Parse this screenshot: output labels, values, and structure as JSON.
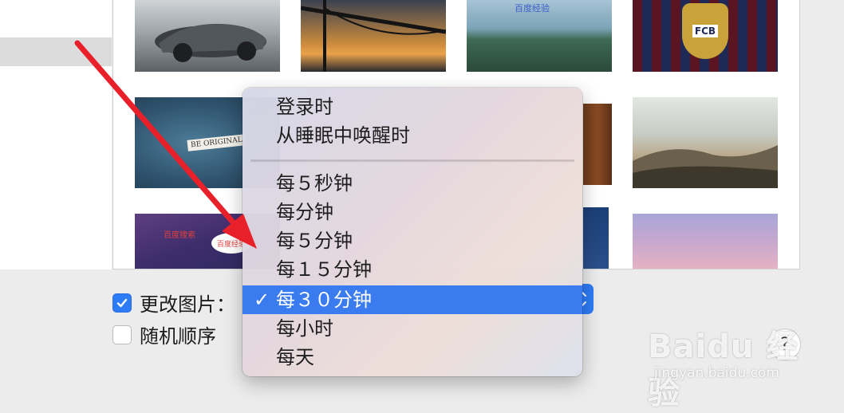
{
  "menu": {
    "items": [
      {
        "label": "登录时",
        "selected": false
      },
      {
        "label": "从睡眠中唤醒时",
        "selected": false
      },
      {
        "label": "每５秒钟",
        "selected": false
      },
      {
        "label": "每分钟",
        "selected": false
      },
      {
        "label": "每５分钟",
        "selected": false
      },
      {
        "label": "每１５分钟",
        "selected": false
      },
      {
        "label": "每３０分钟",
        "selected": true
      },
      {
        "label": "每小时",
        "selected": false
      },
      {
        "label": "每天",
        "selected": false
      }
    ],
    "check_glyph": "✓"
  },
  "options": {
    "change_picture_label": "更改图片：",
    "change_picture_checked": true,
    "random_order_label": "随机顺序",
    "random_order_checked": false
  },
  "help": {
    "label": "?"
  },
  "thumbnails": [
    {
      "name": "thumbnail-concept-car",
      "caption": ""
    },
    {
      "name": "thumbnail-bridge-sunset",
      "caption": ""
    },
    {
      "name": "thumbnail-sea-cliffs",
      "caption": "百度经验"
    },
    {
      "name": "thumbnail-fcb-crest",
      "caption": "FCB"
    },
    {
      "name": "thumbnail-be-original",
      "caption": "BE ORIGINAL"
    },
    {
      "name": "thumbnail-wood",
      "caption": ""
    },
    {
      "name": "thumbnail-dunes",
      "caption": ""
    },
    {
      "name": "thumbnail-baidu-purple",
      "caption": "百度搜索"
    },
    {
      "name": "thumbnail-baidu-bubble",
      "caption": "百度经验"
    },
    {
      "name": "thumbnail-blue-night",
      "caption": ""
    },
    {
      "name": "thumbnail-pink-sky",
      "caption": ""
    }
  ],
  "watermark": {
    "brand": "Baidu 经验",
    "url": "jingyan.baidu.com"
  },
  "colors": {
    "accent": "#2d7cf6",
    "menu_selected": "#3a7cf0",
    "annotation_arrow": "#e8202a"
  }
}
